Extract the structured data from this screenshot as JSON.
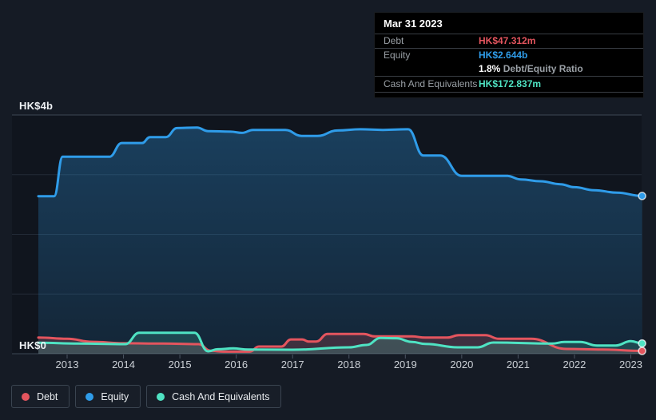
{
  "colors": {
    "page_bg": "#151b25",
    "plot_bg": "#10151e",
    "gridline_inner": "#222b37",
    "axis_line": "#3d4754",
    "tick": "#4b5563",
    "tooltip_bg": "#000000",
    "tooltip_divider": "#393e44",
    "debt": "#e4555e",
    "equity": "#2f9ce9",
    "cash": "#4fe3c3"
  },
  "tooltip": {
    "title": "Mar 31 2023",
    "debt_label": "Debt",
    "debt_value": "HK$47.312m",
    "equity_label": "Equity",
    "equity_value": "HK$2.644b",
    "ratio_value": "1.8%",
    "ratio_label": "Debt/Equity Ratio",
    "cash_label": "Cash And Equivalents",
    "cash_value": "HK$172.837m"
  },
  "chart_data": {
    "type": "area",
    "title": "",
    "unit": "HK$ billions",
    "grid": true,
    "legend_position": "bottom",
    "y_axis": {
      "min": 0,
      "max": 4,
      "gridline_values": [
        4,
        3,
        2,
        1,
        0
      ],
      "labels": [
        {
          "text": "HK$4b",
          "value": 4
        },
        {
          "text": "HK$0",
          "value": 0
        }
      ]
    },
    "x_axis": {
      "tick_years": [
        2013,
        2014,
        2015,
        2016,
        2017,
        2018,
        2019,
        2020,
        2021,
        2022,
        2023
      ],
      "data_range_years": [
        2012.49,
        2023.2
      ]
    },
    "series": [
      {
        "name": "Debt",
        "color": "#e4555e",
        "fill": "rgba(228,85,94,0.20)",
        "points": [
          [
            2012.49,
            0.27
          ],
          [
            2013.0,
            0.25
          ],
          [
            2013.45,
            0.2
          ],
          [
            2014.0,
            0.175
          ],
          [
            2014.7,
            0.17
          ],
          [
            2015.33,
            0.16
          ],
          [
            2015.55,
            0.05
          ],
          [
            2015.78,
            0.035
          ],
          [
            2016.24,
            0.035
          ],
          [
            2016.4,
            0.12
          ],
          [
            2016.8,
            0.12
          ],
          [
            2016.97,
            0.24
          ],
          [
            2017.17,
            0.24
          ],
          [
            2017.28,
            0.205
          ],
          [
            2017.42,
            0.205
          ],
          [
            2017.62,
            0.33
          ],
          [
            2018.26,
            0.33
          ],
          [
            2018.46,
            0.29
          ],
          [
            2019.12,
            0.29
          ],
          [
            2019.35,
            0.27
          ],
          [
            2019.74,
            0.27
          ],
          [
            2019.95,
            0.31
          ],
          [
            2020.42,
            0.31
          ],
          [
            2020.66,
            0.25
          ],
          [
            2021.23,
            0.25
          ],
          [
            2021.86,
            0.08
          ],
          [
            2022.5,
            0.07
          ],
          [
            2023.2,
            0.047
          ]
        ]
      },
      {
        "name": "Equity",
        "color": "#2f9ce9",
        "fill": "gradient",
        "points": [
          [
            2012.49,
            2.64
          ],
          [
            2012.77,
            2.64
          ],
          [
            2012.92,
            3.3
          ],
          [
            2013.75,
            3.3
          ],
          [
            2013.97,
            3.53
          ],
          [
            2014.33,
            3.53
          ],
          [
            2014.47,
            3.63
          ],
          [
            2014.75,
            3.63
          ],
          [
            2014.95,
            3.78
          ],
          [
            2015.3,
            3.79
          ],
          [
            2015.5,
            3.73
          ],
          [
            2015.9,
            3.72
          ],
          [
            2016.1,
            3.7
          ],
          [
            2016.3,
            3.75
          ],
          [
            2016.87,
            3.75
          ],
          [
            2017.16,
            3.65
          ],
          [
            2017.44,
            3.65
          ],
          [
            2017.8,
            3.74
          ],
          [
            2018.2,
            3.76
          ],
          [
            2018.6,
            3.75
          ],
          [
            2019.05,
            3.76
          ],
          [
            2019.32,
            3.32
          ],
          [
            2019.62,
            3.32
          ],
          [
            2020.0,
            2.98
          ],
          [
            2020.8,
            2.98
          ],
          [
            2021.05,
            2.92
          ],
          [
            2021.4,
            2.89
          ],
          [
            2021.75,
            2.84
          ],
          [
            2022.0,
            2.79
          ],
          [
            2022.35,
            2.74
          ],
          [
            2022.75,
            2.7
          ],
          [
            2023.2,
            2.644
          ]
        ]
      },
      {
        "name": "Cash And Equivalents",
        "color": "#4fe3c3",
        "fill": "rgba(79,227,195,0.18)",
        "points": [
          [
            2012.49,
            0.185
          ],
          [
            2013.2,
            0.17
          ],
          [
            2014.03,
            0.16
          ],
          [
            2014.28,
            0.35
          ],
          [
            2015.26,
            0.35
          ],
          [
            2015.5,
            0.04
          ],
          [
            2015.67,
            0.075
          ],
          [
            2015.95,
            0.09
          ],
          [
            2016.21,
            0.07
          ],
          [
            2017.0,
            0.067
          ],
          [
            2018.0,
            0.107
          ],
          [
            2018.31,
            0.147
          ],
          [
            2018.56,
            0.263
          ],
          [
            2018.84,
            0.26
          ],
          [
            2019.12,
            0.197
          ],
          [
            2019.36,
            0.163
          ],
          [
            2019.93,
            0.107
          ],
          [
            2020.28,
            0.107
          ],
          [
            2020.56,
            0.187
          ],
          [
            2021.6,
            0.17
          ],
          [
            2021.82,
            0.197
          ],
          [
            2022.1,
            0.197
          ],
          [
            2022.4,
            0.138
          ],
          [
            2022.73,
            0.138
          ],
          [
            2023.0,
            0.21
          ],
          [
            2023.2,
            0.173
          ]
        ]
      }
    ]
  }
}
